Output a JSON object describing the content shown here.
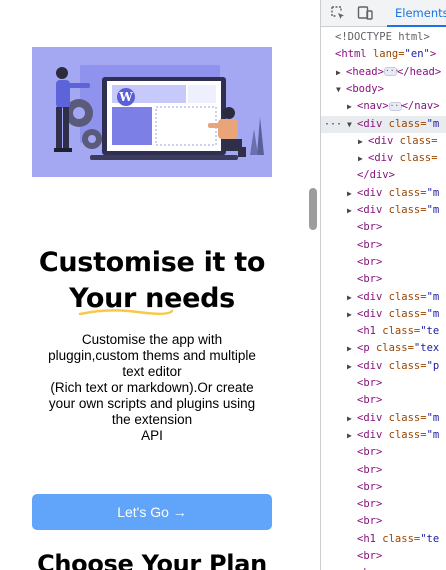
{
  "page": {
    "heading_line1": "Customise it to",
    "heading_line2": "Your needs",
    "paragraph_lines": [
      "Customise the app with",
      "pluggin,custom thems and multiple",
      "text editor",
      "(Rich text or markdown).Or create",
      "your own scripts and plugins using",
      "the extension",
      "API"
    ],
    "cta_label": "Let's Go →",
    "section_heading": "Choose Your Plan",
    "hero_logo_letter": "W"
  },
  "colors": {
    "hero_background": "#a4a8f3",
    "cta_background": "#60a5fa",
    "underline": "#f6c94a",
    "devtools_tab_accent": "#1a73e8"
  },
  "devtools": {
    "active_tab": "Elements",
    "icons": [
      "inspect-element-icon",
      "device-toolbar-icon"
    ],
    "tree": [
      {
        "indent": 0,
        "toggle": "",
        "tag": "<!DOCTYPE html>",
        "gray": true
      },
      {
        "indent": 0,
        "toggle": "",
        "tag": "<html",
        "attr": " lang=",
        "val": "\"en\"",
        "rest": ">"
      },
      {
        "indent": 1,
        "toggle": "▶",
        "tag": "<head>",
        "ell": true,
        "rest": "</head>"
      },
      {
        "indent": 1,
        "toggle": "▼",
        "tag": "<body>"
      },
      {
        "indent": 2,
        "toggle": "▶",
        "tag": "<nav>",
        "ell": true,
        "rest": "</nav>"
      },
      {
        "indent": 2,
        "toggle": "▼",
        "tag": "<div",
        "attr": " class=",
        "val": "\"m",
        "selected": true
      },
      {
        "indent": 3,
        "toggle": "▶",
        "tag": "<div",
        "attr": " class=",
        "val": ""
      },
      {
        "indent": 3,
        "toggle": "▶",
        "tag": "<div",
        "attr": " class=",
        "val": ""
      },
      {
        "indent": 2,
        "toggle": "",
        "tag": "</div>"
      },
      {
        "indent": 2,
        "toggle": "▶",
        "tag": "<div",
        "attr": " class=",
        "val": "\"m"
      },
      {
        "indent": 2,
        "toggle": "▶",
        "tag": "<div",
        "attr": " class=",
        "val": "\"m"
      },
      {
        "indent": 2,
        "toggle": "",
        "tag": "<br>"
      },
      {
        "indent": 2,
        "toggle": "",
        "tag": "<br>"
      },
      {
        "indent": 2,
        "toggle": "",
        "tag": "<br>"
      },
      {
        "indent": 2,
        "toggle": "",
        "tag": "<br>"
      },
      {
        "indent": 2,
        "toggle": "▶",
        "tag": "<div",
        "attr": " class=",
        "val": "\"m"
      },
      {
        "indent": 2,
        "toggle": "▶",
        "tag": "<div",
        "attr": " class=",
        "val": "\"m"
      },
      {
        "indent": 2,
        "toggle": "",
        "tag": "<h1",
        "attr": " class=",
        "val": "\"te"
      },
      {
        "indent": 2,
        "toggle": "▶",
        "tag": "<p",
        "attr": " class=",
        "val": "\"tex"
      },
      {
        "indent": 2,
        "toggle": "▶",
        "tag": "<div",
        "attr": " class=",
        "val": "\"p"
      },
      {
        "indent": 2,
        "toggle": "",
        "tag": "<br>"
      },
      {
        "indent": 2,
        "toggle": "",
        "tag": "<br>"
      },
      {
        "indent": 2,
        "toggle": "▶",
        "tag": "<div",
        "attr": " class=",
        "val": "\"m"
      },
      {
        "indent": 2,
        "toggle": "▶",
        "tag": "<div",
        "attr": " class=",
        "val": "\"m"
      },
      {
        "indent": 2,
        "toggle": "",
        "tag": "<br>"
      },
      {
        "indent": 2,
        "toggle": "",
        "tag": "<br>"
      },
      {
        "indent": 2,
        "toggle": "",
        "tag": "<br>"
      },
      {
        "indent": 2,
        "toggle": "",
        "tag": "<br>"
      },
      {
        "indent": 2,
        "toggle": "",
        "tag": "<br>"
      },
      {
        "indent": 2,
        "toggle": "",
        "tag": "<h1",
        "attr": " class=",
        "val": "\"te"
      },
      {
        "indent": 2,
        "toggle": "",
        "tag": "<br>"
      },
      {
        "indent": 2,
        "toggle": "",
        "tag": "<br>"
      }
    ]
  }
}
